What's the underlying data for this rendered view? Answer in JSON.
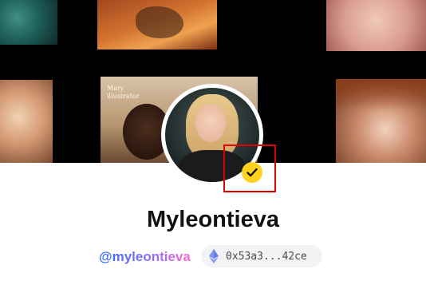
{
  "banner": {
    "artworks": [
      {
        "name": "artwork-teal-figure"
      },
      {
        "name": "artwork-orange-figure"
      },
      {
        "name": "artwork-hand-skin"
      },
      {
        "name": "artwork-laughing-face"
      },
      {
        "name": "artwork-mary-illustrator",
        "caption": "Mary\nillustrator"
      },
      {
        "name": "artwork-redhead-portrait"
      }
    ]
  },
  "profile": {
    "display_name": "Myleontieva",
    "handle": "@myleontieva",
    "wallet_address": "0x53a3...42ce",
    "wallet_icon": "ethereum-icon",
    "verified_icon": "verified-check-icon",
    "colors": {
      "verified_badge": "#ffd21f",
      "highlight_box": "#e00000",
      "handle_gradient_start": "#2f6bff",
      "handle_gradient_end": "#ff6ad5"
    }
  }
}
